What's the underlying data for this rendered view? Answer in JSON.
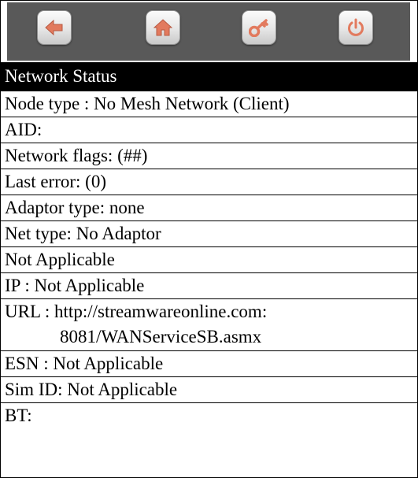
{
  "toolbar": {
    "back_icon": "back-arrow-icon",
    "home_icon": "home-icon",
    "key_icon": "key-icon",
    "power_icon": "power-icon",
    "icon_color": "#e27a5e"
  },
  "header": {
    "title": "Network Status"
  },
  "rows": {
    "node_type": "Node type : No Mesh Network (Client)",
    "aid": "AID:",
    "network_flags": "Network flags: (##)",
    "last_error": "Last error: (0)",
    "adaptor_type": "Adaptor type: none",
    "net_type": "Net type: No Adaptor",
    "not_applicable": "Not Applicable",
    "ip": "IP : Not Applicable",
    "url_line1": "URL : http://streamwareonline.com:",
    "url_line2": "8081/WANServiceSB.asmx",
    "esn": "ESN : Not Applicable",
    "sim_id": "Sim ID: Not Applicable",
    "bt": "BT:"
  }
}
